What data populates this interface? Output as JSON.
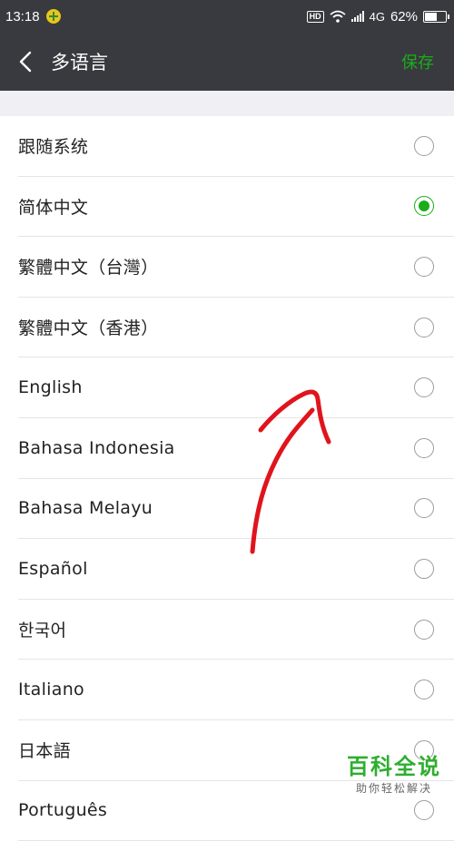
{
  "status_bar": {
    "time": "13:18",
    "hd": "HD",
    "network": "4G",
    "battery": "62%",
    "battery_level": 0.62
  },
  "nav": {
    "title": "多语言",
    "save_label": "保存"
  },
  "languages": [
    {
      "label": "跟随系统",
      "selected": false
    },
    {
      "label": "简体中文",
      "selected": true
    },
    {
      "label": "繁體中文（台灣）",
      "selected": false
    },
    {
      "label": "繁體中文（香港）",
      "selected": false
    },
    {
      "label": "English",
      "selected": false
    },
    {
      "label": "Bahasa Indonesia",
      "selected": false
    },
    {
      "label": "Bahasa Melayu",
      "selected": false
    },
    {
      "label": "Español",
      "selected": false
    },
    {
      "label": "한국어",
      "selected": false
    },
    {
      "label": "Italiano",
      "selected": false
    },
    {
      "label": "日本語",
      "selected": false
    },
    {
      "label": "Português",
      "selected": false
    }
  ],
  "watermark": {
    "title": "百科全说",
    "subtitle": "助你轻松解决"
  },
  "colors": {
    "accent": "#1aad19",
    "header_bg": "#393a3f",
    "annotation": "#e0141c"
  }
}
